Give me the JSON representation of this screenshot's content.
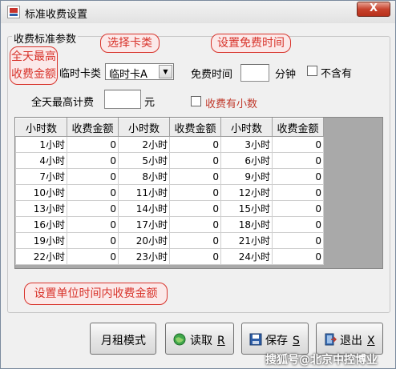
{
  "window": {
    "title": "标准收费设置",
    "close_label": "X"
  },
  "group": {
    "title": "收费标准参数"
  },
  "form": {
    "card_type_label": "临时卡类",
    "card_type_value": "临时卡A",
    "free_time_label": "免费时间",
    "free_time_value": "",
    "minute_label": "分钟",
    "exclude_label": "不含有",
    "daily_max_label": "全天最高计费",
    "daily_max_value": "",
    "yuan_label": "元",
    "decimal_label": "收费有小数"
  },
  "callouts": {
    "daily_max": "全天最高\n收费金额",
    "daily_max_line1": "全天最高",
    "daily_max_line2": "收费金额",
    "select_card": "选择卡类",
    "set_free_time": "设置免费时间",
    "set_unit_fee": "设置单位时间内收费金额"
  },
  "table": {
    "headers": [
      "小时数",
      "收费金额",
      "小时数",
      "收费金额",
      "小时数",
      "收费金额"
    ],
    "rows": [
      [
        "1小时",
        "0",
        "2小时",
        "0",
        "3小时",
        "0"
      ],
      [
        "4小时",
        "0",
        "5小时",
        "0",
        "6小时",
        "0"
      ],
      [
        "7小时",
        "0",
        "8小时",
        "0",
        "9小时",
        "0"
      ],
      [
        "10小时",
        "0",
        "11小时",
        "0",
        "12小时",
        "0"
      ],
      [
        "13小时",
        "0",
        "14小时",
        "0",
        "15小时",
        "0"
      ],
      [
        "16小时",
        "0",
        "17小时",
        "0",
        "18小时",
        "0"
      ],
      [
        "19小时",
        "0",
        "20小时",
        "0",
        "21小时",
        "0"
      ],
      [
        "22小时",
        "0",
        "23小时",
        "0",
        "24小时",
        "0"
      ]
    ]
  },
  "buttons": {
    "monthly": "月租模式",
    "read": "读取",
    "read_key": "R",
    "save": "保存",
    "save_key": "S",
    "exit": "退出",
    "exit_key": "X"
  },
  "watermark": "搜狐号@北京中控博业",
  "colors": {
    "callout_red": "#d8342c",
    "decimal_label_red": "#c0392b"
  }
}
